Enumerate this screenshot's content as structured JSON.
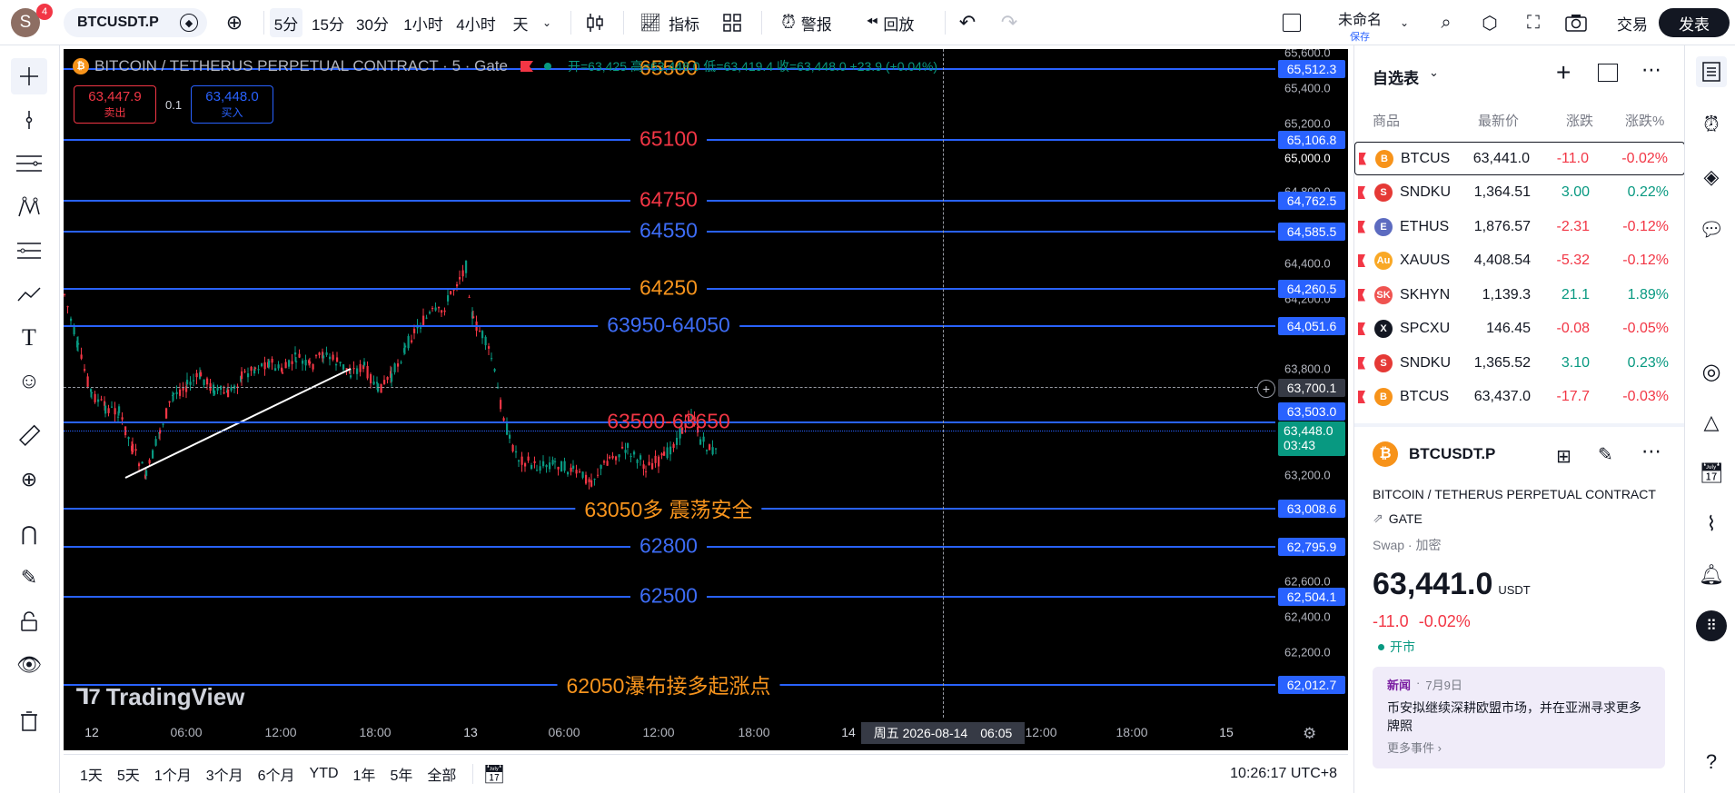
{
  "top_toolbar": {
    "avatar_letter": "S",
    "notification_count": "4",
    "symbol": "BTCUSDT.P",
    "intervals": [
      "5分",
      "15分",
      "30分",
      "1小时",
      "4小时",
      "天"
    ],
    "active_interval": "5分",
    "indicators_label": "指标",
    "alert_label": "警报",
    "replay_label": "回放",
    "layout_name": "未命名",
    "layout_status": "保存",
    "trade_label": "交易",
    "publish_label": "发表"
  },
  "chart": {
    "legend_title": "BITCOIN / TETHERUS PERPETUAL CONTRACT · 5 · Gate",
    "ohlc_text": "开=63,425 高=63,448.0 低=63,419.4 收=63,448.0 +23.9 (+0.04%)",
    "sell_price": "63,447.9",
    "sell_label": "卖出",
    "spread": "0.1",
    "buy_price": "63,448.0",
    "buy_label": "买入",
    "watermark": "TradingView",
    "level_labels": {
      "l65500": "65500",
      "l65100": "65100",
      "l64750": "64750",
      "l64550": "64550",
      "l64250": "64250",
      "l63950": "63950-64050",
      "l63500": "63500-63650",
      "l63050": "63050多  震荡安全",
      "l62800": "62800",
      "l62500": "62500",
      "l62050": "62050瀑布接多起涨点"
    },
    "crosshair_date": "周五 2026-08-14",
    "crosshair_time": "06:05",
    "crosshair_price": "63,700.1"
  },
  "price_scale": {
    "ticks": [
      "65,600.0",
      "65,400.0",
      "65,200.0",
      "65,000.0",
      "64,800.0",
      "64,400.0",
      "64,200.0",
      "63,800.0",
      "63,200.0",
      "62,600.0",
      "62,400.0",
      "62,200.0"
    ],
    "line_tags": [
      "65,512.3",
      "65,106.8",
      "64,762.5",
      "64,585.5",
      "64,260.5",
      "64,051.6",
      "63,503.0",
      "63,008.6",
      "62,795.9",
      "62,504.1",
      "62,012.7"
    ],
    "last_price": "63,448.0",
    "countdown": "03:43"
  },
  "time_scale": {
    "ticks": [
      "12",
      "06:00",
      "12:00",
      "18:00",
      "13",
      "06:00",
      "12:00",
      "18:00",
      "14",
      "12:00",
      "18:00",
      "15"
    ]
  },
  "bottom_bar": {
    "ranges": [
      "1天",
      "5天",
      "1个月",
      "3个月",
      "6个月",
      "YTD",
      "1年",
      "5年",
      "全部"
    ],
    "clock": "10:26:17 UTC+8"
  },
  "watchlist": {
    "title": "自选表",
    "columns": [
      "商品",
      "最新价",
      "涨跌",
      "涨跌%"
    ],
    "rows": [
      {
        "sym": "BTCUS",
        "last": "63,441.0",
        "chg": "-11.0",
        "pct": "-0.02%",
        "dir": "dn",
        "icon": "B",
        "color": "#f7931a"
      },
      {
        "sym": "SNDKU",
        "last": "1,364.51",
        "chg": "3.00",
        "pct": "0.22%",
        "dir": "up",
        "icon": "S",
        "color": "#e53935"
      },
      {
        "sym": "ETHUS",
        "last": "1,876.57",
        "chg": "-2.31",
        "pct": "-0.12%",
        "dir": "dn",
        "icon": "E",
        "color": "#5c6bc0"
      },
      {
        "sym": "XAUUS",
        "last": "4,408.54",
        "chg": "-5.32",
        "pct": "-0.12%",
        "dir": "dn",
        "icon": "Au",
        "color": "#f9a825"
      },
      {
        "sym": "SKHYN",
        "last": "1,139.3",
        "chg": "21.1",
        "pct": "1.89%",
        "dir": "up",
        "icon": "SK",
        "color": "#ef5350"
      },
      {
        "sym": "SPCXU",
        "last": "146.45",
        "chg": "-0.08",
        "pct": "-0.05%",
        "dir": "dn",
        "icon": "X",
        "color": "#131722"
      },
      {
        "sym": "SNDKU",
        "last": "1,365.52",
        "chg": "3.10",
        "pct": "0.23%",
        "dir": "up",
        "icon": "S",
        "color": "#e53935"
      },
      {
        "sym": "BTCUS",
        "last": "63,437.0",
        "chg": "-17.7",
        "pct": "-0.03%",
        "dir": "dn",
        "icon": "B",
        "color": "#f7931a"
      }
    ]
  },
  "details": {
    "symbol": "BTCUSDT.P",
    "full_name": "BITCOIN / TETHERUS PERPETUAL CONTRACT",
    "exchange": "GATE",
    "type_a": "Swap",
    "type_b": "加密",
    "price_main": "63,441.0",
    "currency": "USDT",
    "change": "-11.0",
    "change_pct": "-0.02%",
    "market_status": "开市",
    "news_tag": "新闻",
    "news_date": "7月9日",
    "news_text": "币安拟继续深耕欧盟市场，并在亚洲寻求更多牌照",
    "more_events": "更多事件 ›"
  }
}
